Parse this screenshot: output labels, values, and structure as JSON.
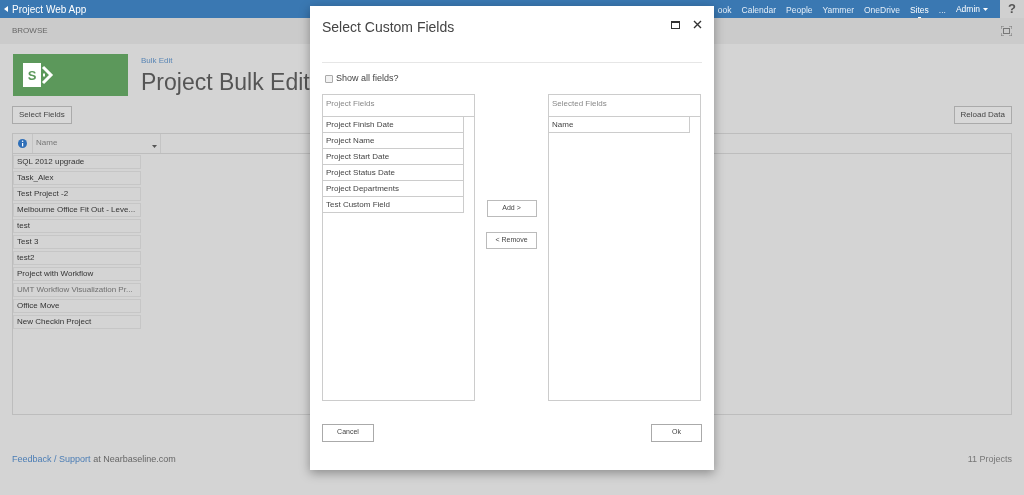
{
  "suite_bar": {
    "app_name": "Project Web App",
    "nav": [
      {
        "label": "ook",
        "selected": false
      },
      {
        "label": "Calendar",
        "selected": false
      },
      {
        "label": "People",
        "selected": false
      },
      {
        "label": "Yammer",
        "selected": false
      },
      {
        "label": "OneDrive",
        "selected": false
      },
      {
        "label": "Sites",
        "selected": true
      },
      {
        "label": "...",
        "selected": false
      }
    ],
    "user": "Admin",
    "help": "?"
  },
  "ribbon": {
    "tab": "BROWSE"
  },
  "page": {
    "logo_letter": "S",
    "breadcrumb": "Bulk Edit",
    "title": "Project Bulk Edit",
    "select_fields_button": "Select Fields",
    "reload_button": "Reload Data"
  },
  "grid": {
    "columns": [
      "Name"
    ],
    "rows": [
      {
        "name": "SQL 2012 upgrade",
        "disabled": false
      },
      {
        "name": "Task_Alex",
        "disabled": false
      },
      {
        "name": "Test Project -2",
        "disabled": false
      },
      {
        "name": "Melbourne Office Fit Out - Leve...",
        "disabled": false
      },
      {
        "name": "test",
        "disabled": false
      },
      {
        "name": "Test 3",
        "disabled": false
      },
      {
        "name": "test2",
        "disabled": false
      },
      {
        "name": "Project with Workflow",
        "disabled": false
      },
      {
        "name": "UMT Workflow Visualization Pr...",
        "disabled": true
      },
      {
        "name": "Office Move",
        "disabled": false
      },
      {
        "name": "New Checkin Project",
        "disabled": false
      }
    ]
  },
  "footer": {
    "feedback": "Feedback",
    "separator": "/",
    "support": "Support",
    "suffix": "at Nearbaseline.com",
    "count": "11 Projects"
  },
  "dialog": {
    "title": "Select Custom Fields",
    "show_all": {
      "label": "Show all fields?",
      "checked": false
    },
    "available": {
      "heading": "Project Fields",
      "items": [
        "Project Finish Date",
        "Project Name",
        "Project Start Date",
        "Project Status Date",
        "Project Departments",
        "Test Custom Field"
      ]
    },
    "selected": {
      "heading": "Selected Fields",
      "items": [
        "Name"
      ]
    },
    "add_button": "Add >",
    "remove_button": "< Remove",
    "cancel_button": "Cancel",
    "ok_button": "Ok"
  }
}
